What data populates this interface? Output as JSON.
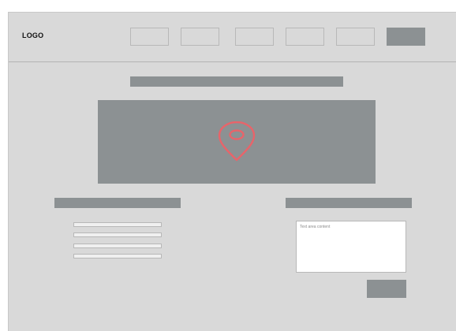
{
  "header": {
    "logo": "LOGO"
  },
  "main": {
    "textarea_content": "Text area content"
  },
  "colors": {
    "background": "#d9d9d9",
    "placeholder_block": "#8c9193",
    "pin": "#e8646a"
  },
  "icons": {
    "map": "map-pin-icon"
  }
}
